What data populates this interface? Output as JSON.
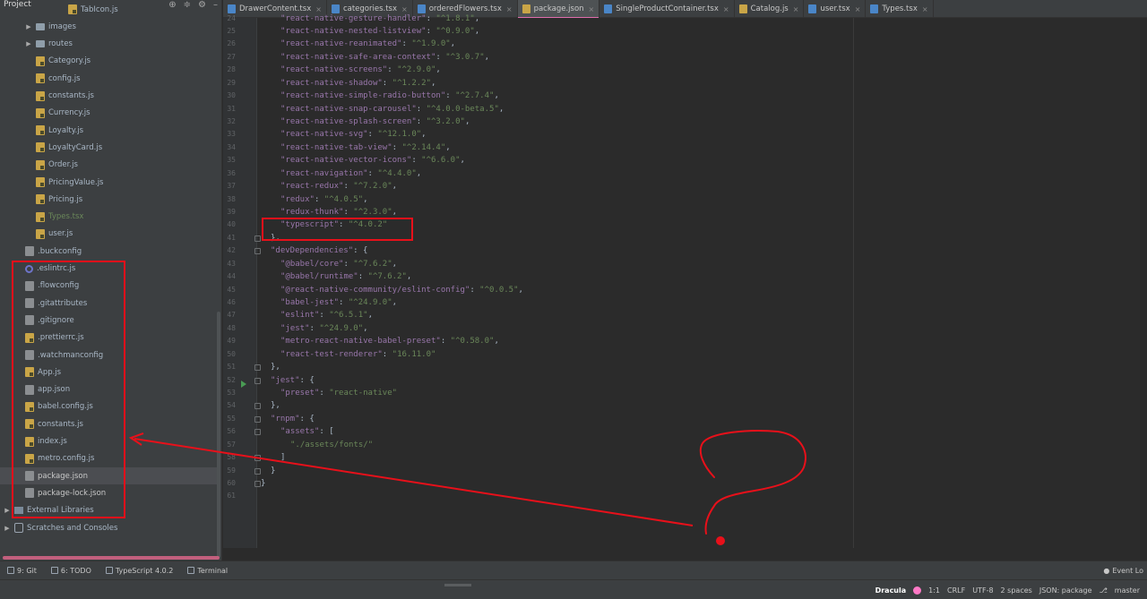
{
  "project_panel": {
    "title": "Project",
    "tree": [
      {
        "label": "TabIcon.js",
        "icon": "js",
        "indent": 76
      },
      {
        "label": "images",
        "icon": "folder",
        "indent": 40,
        "expandable": true
      },
      {
        "label": "routes",
        "icon": "folder",
        "indent": 40,
        "expandable": true
      },
      {
        "label": "Category.js",
        "icon": "js",
        "indent": 40
      },
      {
        "label": "config.js",
        "icon": "js",
        "indent": 40
      },
      {
        "label": "constants.js",
        "icon": "js",
        "indent": 40
      },
      {
        "label": "Currency.js",
        "icon": "js",
        "indent": 40
      },
      {
        "label": "Loyalty.js",
        "icon": "js",
        "indent": 40
      },
      {
        "label": "LoyaltyCard.js",
        "icon": "js",
        "indent": 40
      },
      {
        "label": "Order.js",
        "icon": "js",
        "indent": 40
      },
      {
        "label": "PricingValue.js",
        "icon": "js",
        "indent": 40
      },
      {
        "label": "Pricing.js",
        "icon": "js",
        "indent": 40
      },
      {
        "label": "Types.tsx",
        "icon": "js",
        "indent": 40,
        "style": "ts"
      },
      {
        "label": "user.js",
        "icon": "js",
        "indent": 40
      },
      {
        "label": ".buckconfig",
        "icon": "file",
        "indent": 28
      },
      {
        "label": ".eslintrc.js",
        "icon": "circle",
        "indent": 28
      },
      {
        "label": ".flowconfig",
        "icon": "file",
        "indent": 28
      },
      {
        "label": ".gitattributes",
        "icon": "file",
        "indent": 28
      },
      {
        "label": ".gitignore",
        "icon": "file",
        "indent": 28
      },
      {
        "label": ".prettierrc.js",
        "icon": "js",
        "indent": 28
      },
      {
        "label": ".watchmanconfig",
        "icon": "file",
        "indent": 28
      },
      {
        "label": "App.js",
        "icon": "js",
        "indent": 28
      },
      {
        "label": "app.json",
        "icon": "file",
        "indent": 28
      },
      {
        "label": "babel.config.js",
        "icon": "js",
        "indent": 28
      },
      {
        "label": "constants.js",
        "icon": "js",
        "indent": 28
      },
      {
        "label": "index.js",
        "icon": "js",
        "indent": 28
      },
      {
        "label": "metro.config.js",
        "icon": "js",
        "indent": 28
      },
      {
        "label": "package.json",
        "icon": "file",
        "indent": 28,
        "selected": true,
        "style": "plain"
      },
      {
        "label": "package-lock.json",
        "icon": "file",
        "indent": 28,
        "style": "plain"
      },
      {
        "label": "External Libraries",
        "icon": "lib",
        "indent": 16,
        "expandable": true
      },
      {
        "label": "Scratches and Consoles",
        "icon": "scratch",
        "indent": 16,
        "expandable": true
      }
    ]
  },
  "tabs": [
    {
      "label": "DrawerContent.tsx",
      "icon": "tsx",
      "close": "×"
    },
    {
      "label": "categories.tsx",
      "icon": "tsx",
      "close": "×"
    },
    {
      "label": "orderedFlowers.tsx",
      "icon": "tsx",
      "close": "×"
    },
    {
      "label": "package.json",
      "icon": "json",
      "close": "×",
      "active": true
    },
    {
      "label": "SingleProductContainer.tsx",
      "icon": "tsx",
      "close": "×"
    },
    {
      "label": "Catalog.js",
      "icon": "js",
      "close": "×"
    },
    {
      "label": "user.tsx",
      "icon": "tsx",
      "close": "×"
    },
    {
      "label": "Types.tsx",
      "icon": "tsx",
      "close": "×"
    }
  ],
  "editor": {
    "lines": [
      {
        "n": "24",
        "indent": 1,
        "key": "react-native-gesture-handler",
        "val": "^1.8.1",
        "comma": ","
      },
      {
        "n": "25",
        "indent": 1,
        "key": "react-native-nested-listview",
        "val": "^0.9.0",
        "comma": ","
      },
      {
        "n": "26",
        "indent": 1,
        "key": "react-native-reanimated",
        "val": "^1.9.0",
        "comma": ","
      },
      {
        "n": "27",
        "indent": 1,
        "key": "react-native-safe-area-context",
        "val": "^3.0.7",
        "comma": ","
      },
      {
        "n": "28",
        "indent": 1,
        "key": "react-native-screens",
        "val": "^2.9.0",
        "comma": ","
      },
      {
        "n": "29",
        "indent": 1,
        "key": "react-native-shadow",
        "val": "^1.2.2",
        "comma": ","
      },
      {
        "n": "30",
        "indent": 1,
        "key": "react-native-simple-radio-button",
        "val": "^2.7.4",
        "comma": ","
      },
      {
        "n": "31",
        "indent": 1,
        "key": "react-native-snap-carousel",
        "val": "^4.0.0-beta.5",
        "comma": ","
      },
      {
        "n": "32",
        "indent": 1,
        "key": "react-native-splash-screen",
        "val": "^3.2.0",
        "comma": ","
      },
      {
        "n": "33",
        "indent": 1,
        "key": "react-native-svg",
        "val": "^12.1.0",
        "comma": ","
      },
      {
        "n": "34",
        "indent": 1,
        "key": "react-native-tab-view",
        "val": "^2.14.4",
        "comma": ","
      },
      {
        "n": "35",
        "indent": 1,
        "key": "react-native-vector-icons",
        "val": "^6.6.0",
        "comma": ","
      },
      {
        "n": "36",
        "indent": 1,
        "key": "react-navigation",
        "val": "^4.4.0",
        "comma": ","
      },
      {
        "n": "37",
        "indent": 1,
        "key": "react-redux",
        "val": "^7.2.0",
        "comma": ","
      },
      {
        "n": "38",
        "indent": 1,
        "key": "redux",
        "val": "^4.0.5",
        "comma": ","
      },
      {
        "n": "39",
        "indent": 1,
        "key": "redux-thunk",
        "val": "^2.3.0",
        "comma": ","
      },
      {
        "n": "40",
        "indent": 1,
        "key": "typescript",
        "val": "^4.0.2",
        "comma": ""
      },
      {
        "n": "41",
        "indent": 0,
        "raw": "},"
      },
      {
        "n": "42",
        "indent": 0,
        "key": "devDependencies",
        "open": ": {"
      },
      {
        "n": "43",
        "indent": 1,
        "key": "@babel/core",
        "val": "^7.6.2",
        "comma": ","
      },
      {
        "n": "44",
        "indent": 1,
        "key": "@babel/runtime",
        "val": "^7.6.2",
        "comma": ","
      },
      {
        "n": "45",
        "indent": 1,
        "key": "@react-native-community/eslint-config",
        "val": "^0.0.5",
        "comma": ","
      },
      {
        "n": "46",
        "indent": 1,
        "key": "babel-jest",
        "val": "^24.9.0",
        "comma": ","
      },
      {
        "n": "47",
        "indent": 1,
        "key": "eslint",
        "val": "^6.5.1",
        "comma": ","
      },
      {
        "n": "48",
        "indent": 1,
        "key": "jest",
        "val": "^24.9.0",
        "comma": ","
      },
      {
        "n": "49",
        "indent": 1,
        "key": "metro-react-native-babel-preset",
        "val": "^0.58.0",
        "comma": ","
      },
      {
        "n": "50",
        "indent": 1,
        "key": "react-test-renderer",
        "val": "16.11.0",
        "comma": ""
      },
      {
        "n": "51",
        "indent": 0,
        "raw": "},"
      },
      {
        "n": "52",
        "indent": 0,
        "key": "jest",
        "open": ": {"
      },
      {
        "n": "53",
        "indent": 1,
        "key": "preset",
        "val": "react-native",
        "comma": ""
      },
      {
        "n": "54",
        "indent": 0,
        "raw": "},"
      },
      {
        "n": "55",
        "indent": 0,
        "key": "rnpm",
        "open": ": {"
      },
      {
        "n": "56",
        "indent": 1,
        "key": "assets",
        "open": ": ["
      },
      {
        "n": "57",
        "indent": 2,
        "strval": "./assets/fonts/"
      },
      {
        "n": "58",
        "indent": 1,
        "raw": "]"
      },
      {
        "n": "59",
        "indent": 0,
        "raw": "}"
      },
      {
        "n": "60",
        "indent": -1,
        "raw": "}"
      },
      {
        "n": "61",
        "indent": -1,
        "raw": ""
      }
    ]
  },
  "tool_strip": {
    "items": [
      {
        "label": "9: Git",
        "name": "git"
      },
      {
        "label": "6: TODO",
        "name": "todo"
      },
      {
        "label": "TypeScript 4.0.2",
        "name": "typescript"
      },
      {
        "label": "Terminal",
        "name": "terminal"
      }
    ],
    "event_log": "Event Lo"
  },
  "status": {
    "theme": "Dracula",
    "position": "1:1",
    "line_ending": "CRLF",
    "encoding": "UTF-8",
    "indent": "2 spaces",
    "schema": "JSON: package",
    "branch": "master"
  },
  "colors": {
    "annotation": "#e8101a",
    "accent": "#e06dac"
  }
}
